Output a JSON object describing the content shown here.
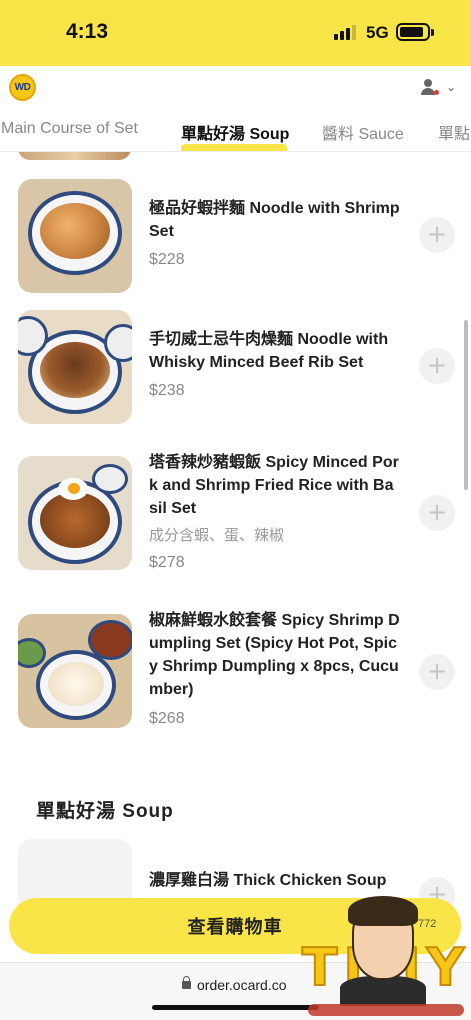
{
  "status_bar": {
    "time": "4:13",
    "network": "5G"
  },
  "header": {
    "logo_text": "WD"
  },
  "tabs": [
    {
      "label": "Main Course of Set",
      "active": false
    },
    {
      "label": "單點好湯 Soup",
      "active": true
    },
    {
      "label": "醬料 Sauce",
      "active": false
    },
    {
      "label": "單點",
      "active": false
    }
  ],
  "items": [
    {
      "name": "極品好蝦拌麵 Noodle with Shrimp Set",
      "desc": "",
      "price": "$228"
    },
    {
      "name": "手切威士忌牛肉燥麵 Noodle with Whisky Minced Beef Rib Set",
      "desc": "",
      "price": "$238"
    },
    {
      "name": "塔香辣炒豬蝦飯 Spicy Minced Pork and Shrimp Fried Rice with Basil Set",
      "desc": "成分含蝦、蛋、辣椒",
      "price": "$278"
    },
    {
      "name": "椒麻鮮蝦水餃套餐 Spicy Shrimp Dumpling Set (Spicy Hot Pot, Spicy Shrimp Dumpling x 8pcs, Cucumber)",
      "desc": "",
      "price": "$268"
    }
  ],
  "section": {
    "title": "單點好湯 Soup"
  },
  "soup_items": [
    {
      "name": "濃厚雞白湯 Thick Chicken Soup"
    }
  ],
  "add_symbol": "+",
  "cart": {
    "label": "查看購物車",
    "count": "772"
  },
  "browser": {
    "url": "order.ocard.co"
  },
  "watermark": {
    "text": "TIMY"
  },
  "colors": {
    "accent": "#f9e547",
    "price": "#888888",
    "add_button_bg": "#f1f1f1"
  },
  "icons": {
    "user": "user-icon",
    "chevron": "chevron-down-icon",
    "lock": "lock-icon",
    "add": "plus-icon"
  }
}
